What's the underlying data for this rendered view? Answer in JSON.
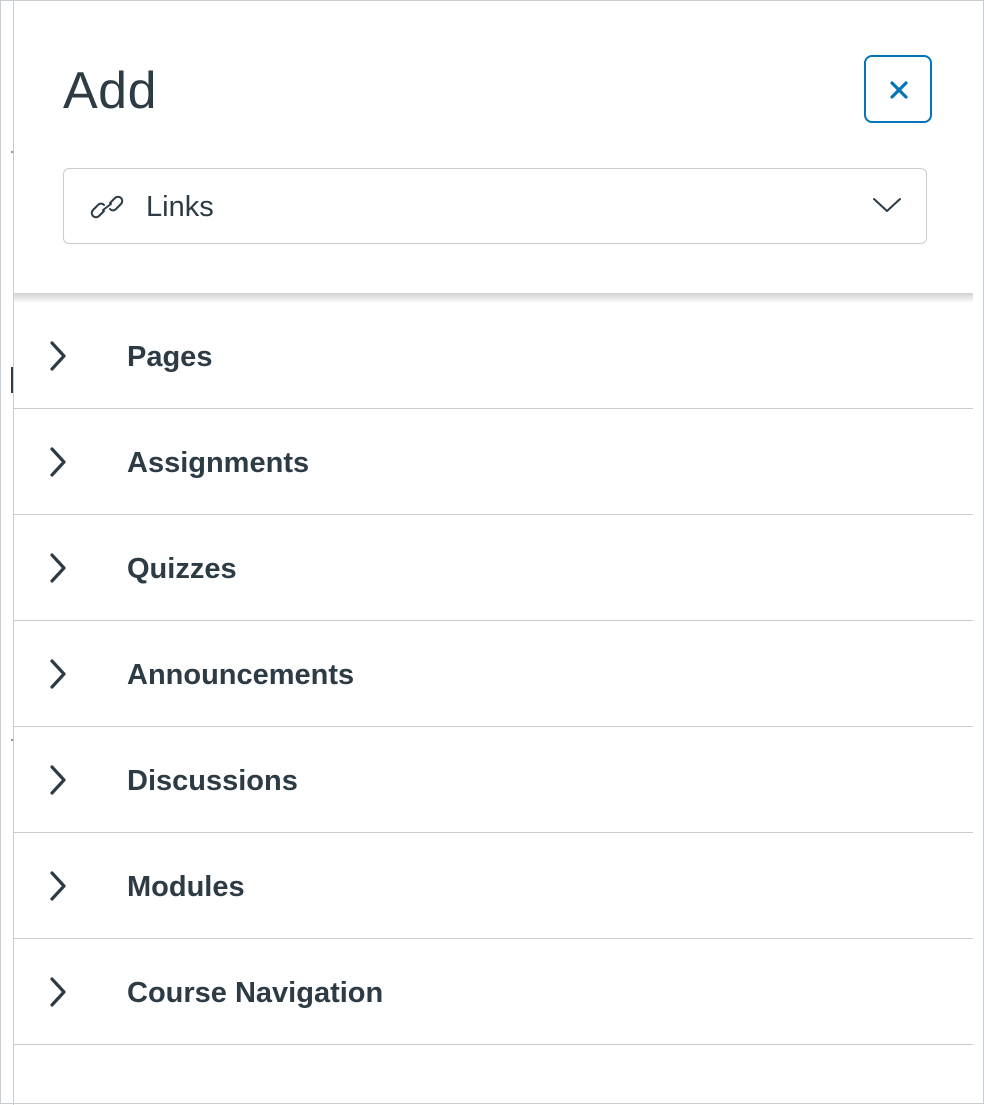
{
  "panel": {
    "title": "Add",
    "close_label": "Close",
    "accent_color": "#0374b5",
    "text_color": "#2d3b45"
  },
  "content_type_select": {
    "icon": "link-icon",
    "selected": "Links"
  },
  "sections": [
    {
      "label": "Pages",
      "expanded": false
    },
    {
      "label": "Assignments",
      "expanded": false
    },
    {
      "label": "Quizzes",
      "expanded": false
    },
    {
      "label": "Announcements",
      "expanded": false
    },
    {
      "label": "Discussions",
      "expanded": false
    },
    {
      "label": "Modules",
      "expanded": false
    },
    {
      "label": "Course Navigation",
      "expanded": false
    }
  ]
}
